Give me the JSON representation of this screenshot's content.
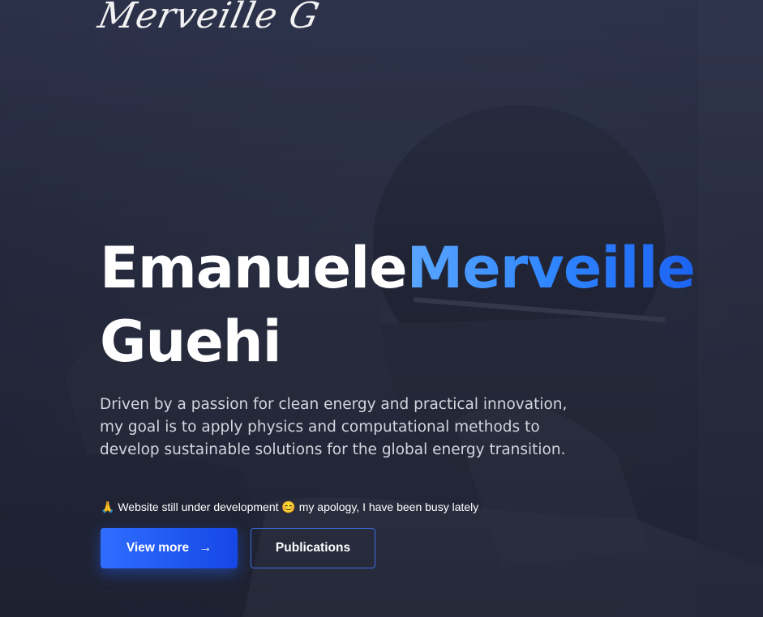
{
  "brand": {
    "logo_text": "Merveille G"
  },
  "hero": {
    "first_name": "Emanuele",
    "middle_name": "Merveille",
    "last_name": "Guehi",
    "intro": "Driven by a passion for clean energy and practical innovation, my goal is to apply physics and computational methods to develop sustainable solutions for the global energy transition.",
    "notice": {
      "leading_emoji": "🙏",
      "text_1": "Website still under development",
      "middle_emoji": "😊",
      "text_2": "my apology, I have been busy lately"
    }
  },
  "buttons": {
    "view_more_label": "View more",
    "view_more_arrow": "→",
    "publications_label": "Publications"
  },
  "colors": {
    "accent_start": "#5aa6ff",
    "accent_end": "#1c63f2",
    "primary_button": "#1f55f0",
    "outline_border": "#3f6fe6"
  }
}
